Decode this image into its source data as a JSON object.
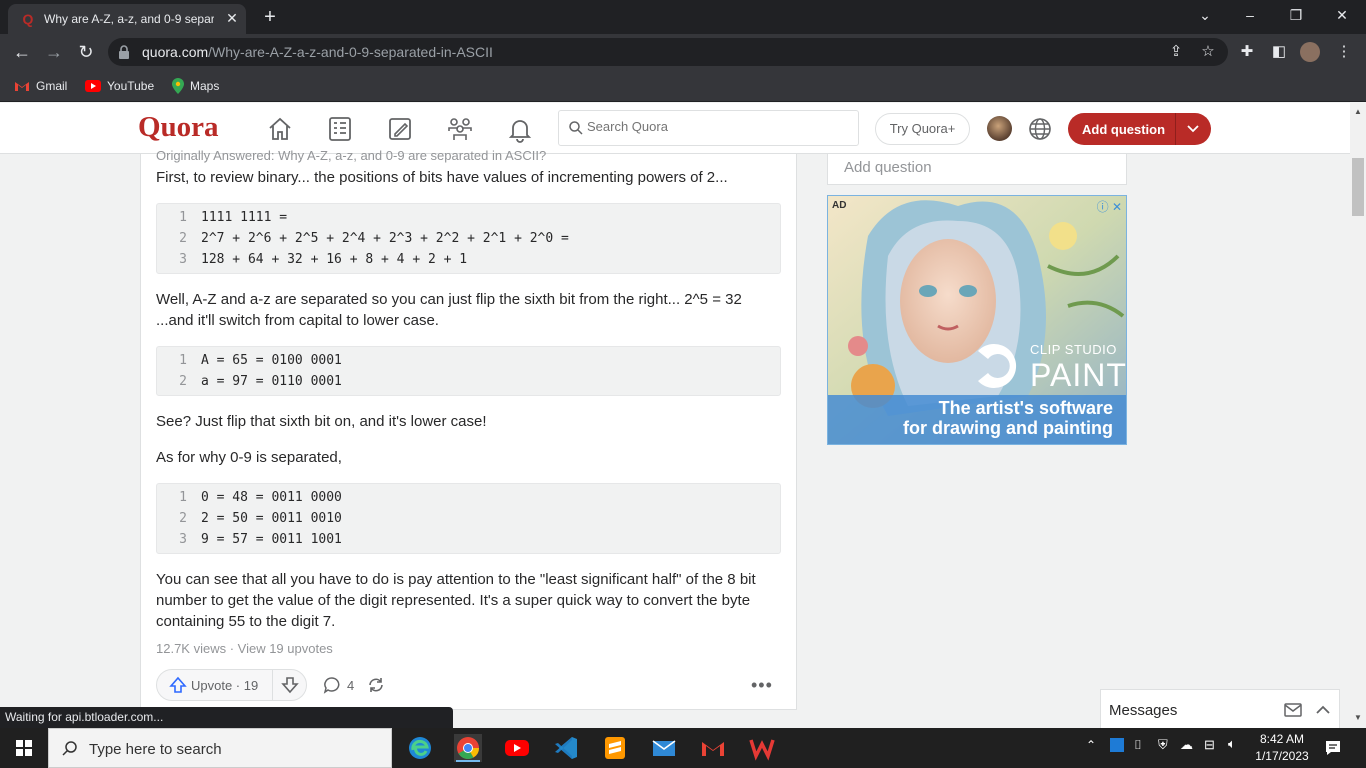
{
  "browser": {
    "tab_title": "Why are A-Z, a-z, and 0-9 separa",
    "url_domain": "quora.com",
    "url_path": "/Why-are-A-Z-a-z-and-0-9-separated-in-ASCII",
    "bookmarks": [
      "Gmail",
      "YouTube",
      "Maps"
    ],
    "status_text": "Waiting for api.btloader.com..."
  },
  "quora": {
    "logo": "Quora",
    "search_placeholder": "Search Quora",
    "try_label": "Try Quora+",
    "add_question_label": "Add question"
  },
  "answer": {
    "originally_answered": "Originally Answered: Why A-Z, a-z, and 0-9 are separated in ASCII?",
    "intro": "First, to review binary... the positions of bits have values of incrementing powers of 2...",
    "code1": [
      {
        "n": "1",
        "t": "1111 1111 ="
      },
      {
        "n": "2",
        "t": "2^7 + 2^6 + 2^5 + 2^4 + 2^3 + 2^2 + 2^1 + 2^0 ="
      },
      {
        "n": "3",
        "t": "128 + 64 + 32 + 16 + 8 + 4 + 2 + 1"
      }
    ],
    "para2": "Well, A-Z and a-z are separated so you can just flip the sixth bit from the right... 2^5 = 32 ...and it'll switch from capital to lower case.",
    "code2": [
      {
        "n": "1",
        "t": "A = 65 = 0100 0001"
      },
      {
        "n": "2",
        "t": "a = 97 = 0110 0001"
      }
    ],
    "para3": "See? Just flip that sixth bit on, and it's lower case!",
    "para4": "As for why 0-9 is separated,",
    "code3": [
      {
        "n": "1",
        "t": "0 = 48 = 0011 0000"
      },
      {
        "n": "2",
        "t": "2 = 50 = 0011 0010"
      },
      {
        "n": "3",
        "t": "9 = 57 = 0011 1001"
      }
    ],
    "para5": "You can see that all you have to do is pay attention to the \"least significant half\" of the 8 bit number to get the value of the digit represented. It's a super quick way to convert the byte containing 55 to the digit 7.",
    "stats": "12.7K views · View 19 upvotes",
    "upvote_label": "Upvote · 19",
    "comments_count": "4"
  },
  "sidebar": {
    "add_question_placeholder": "Add question",
    "ad_label": "AD",
    "ad_brand_line1": "CLIP STUDIO",
    "ad_brand_line2": "PAINT",
    "ad_tagline1": "The artist's software",
    "ad_tagline2": "for drawing and painting"
  },
  "messages_label": "Messages",
  "taskbar": {
    "search_placeholder": "Type here to search",
    "time": "8:42 AM",
    "date": "1/17/2023"
  }
}
